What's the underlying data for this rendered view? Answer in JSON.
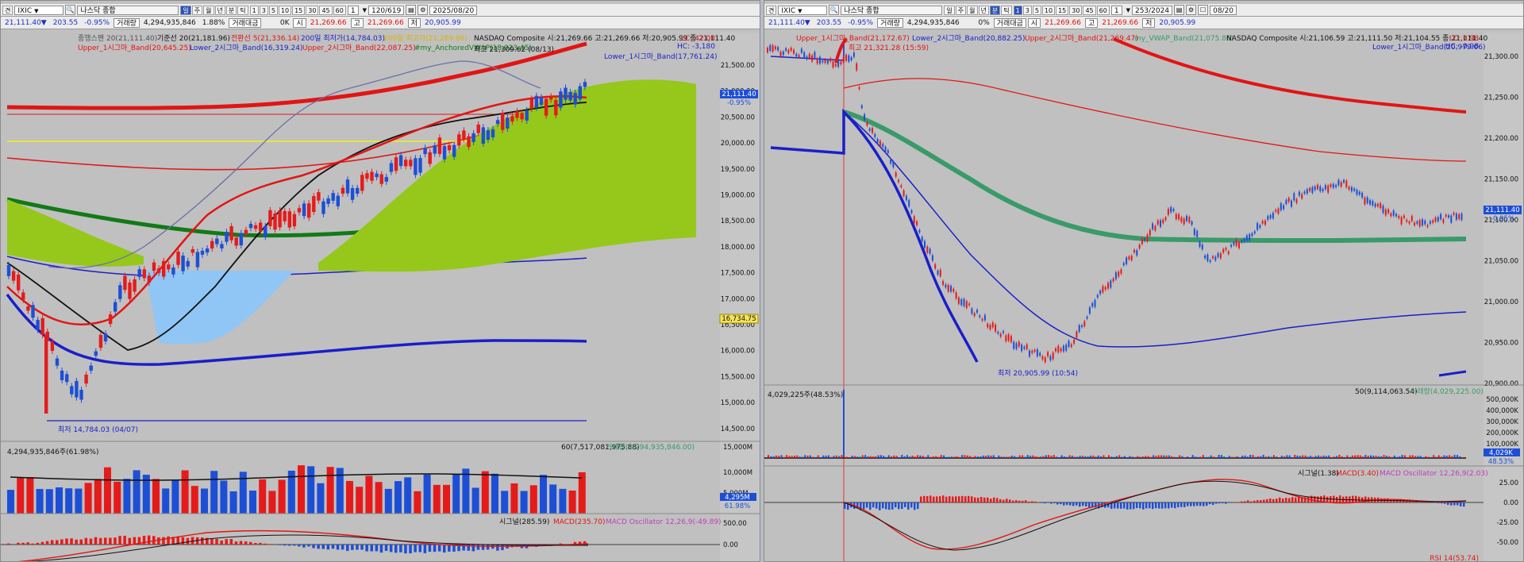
{
  "left": {
    "toolbar1": {
      "market_label": "견",
      "symbol": "IXIC",
      "name": "나스닥 종합",
      "period_buttons": [
        "일",
        "주",
        "월",
        "년",
        "분",
        "틱"
      ],
      "period_selected": 0,
      "intervals": [
        "1",
        "3",
        "5",
        "10",
        "15",
        "30",
        "45",
        "60"
      ],
      "count_value": "1",
      "range_value": "120/619",
      "date_value": "2025/08/20"
    },
    "toolbar2": {
      "price": "21,111.40▼",
      "change": "203.55",
      "change_pct": "-0.95%",
      "volume_label": "거래량",
      "volume": "4,294,935,846",
      "turnover_pct": "1.88%",
      "amount_label": "거래대금",
      "amount": "0K",
      "open_label": "시",
      "open": "21,269.66",
      "high_label": "고",
      "high": "21,269.66",
      "low_label": "저",
      "low": "20,905.99"
    },
    "legend": {
      "line1a": "종행스팬 20(21,111.40)",
      "line1b": "기준선 20(21,181.96)",
      "line1c": "전환선 5(21,336.14)",
      "line1d": "200일 최저가(14,784.03)",
      "line1e": "200일 최고가(21,269.66)",
      "line1f": "NASDAQ Composite 시:21,269.66 고:21,269.66 저:20,905.99 종:21,111.40",
      "line2a": "Upper_1시그마_Band(20,645.25)",
      "line2b": "Lower_2시그마_Band(16,319.24)",
      "line2c": "Upper_2시그마_Band(22,087.25)",
      "line2d": "#my_AnchoredVWAP(18,023.45)",
      "line3a": "Lower_1시그마_Band(17,761.24)",
      "line3b": "최고 21,309.62 (08/13)",
      "lc": "LC: 42.00",
      "hc": "HC: -3,180",
      "min_label": "최저 14,784.03 (04/07)"
    },
    "price_axis": [
      "21,500.00",
      "21,000.00",
      "20,500.00",
      "20,000.00",
      "19,500.00",
      "19,000.00",
      "18,500.00",
      "18,000.00",
      "17,500.00",
      "17,000.00",
      "16,500.00",
      "16,000.00",
      "15,500.00",
      "15,000.00",
      "14,500.00"
    ],
    "price_tag": "21,111.40",
    "price_tag_pct": "-0.95%",
    "vwap_tag": "16,734.75",
    "volume_label": "4,294,935,846주(61.98%)",
    "volume_ma_label": "60(7,517,081,975.88)",
    "volume_legend": "거래량(4,294,935,846.00)",
    "volume_axis": [
      "15,000M",
      "10,000M",
      "5,000M"
    ],
    "volume_tag": "4,295M",
    "volume_tag_pct": "61.98%",
    "macd_labels": [
      "시그널(285.59)",
      "MACD(235.70)",
      "MACD Oscillator 12,26,9(-49.89)"
    ],
    "macd_axis": [
      "500.00",
      "0.00"
    ]
  },
  "right": {
    "toolbar1": {
      "market_label": "견",
      "symbol": "IXIC",
      "name": "나스닥 종합",
      "period_buttons": [
        "일",
        "주",
        "월",
        "년",
        "분",
        "틱"
      ],
      "period_selected": 4,
      "intervals": [
        "1",
        "3",
        "5",
        "10",
        "15",
        "30",
        "45",
        "60"
      ],
      "interval_selected": 0,
      "count_value": "1",
      "range_value": "253/2024",
      "date_value": "08/20"
    },
    "toolbar2": {
      "price": "21,111.40▼",
      "change": "203.55",
      "change_pct": "-0.95%",
      "volume_label": "거래량",
      "volume": "4,294,935,846",
      "amount": "0%",
      "amount_label": "거래대금",
      "open_label": "시",
      "open": "21,269.66",
      "high_label": "고",
      "high": "21,269.66",
      "low_label": "저",
      "low": "20,905.99"
    },
    "legend": {
      "line1a": "Upper_1시그마_Band(21,172.67)",
      "line1b": "Lower_2시그마_Band(20,882.25)",
      "line1c": "Upper_2시그마_Band(21,269.47)",
      "line1d": "my_VWAP_Band(21,075.86)",
      "line1e": "NASDAQ Composite 시:21,106.59 고:21,111.50 저:21,104.55 종:21,111.40",
      "line2a": "Lower_1시그마_Band(20,979.06)",
      "high_label": "최고 21,321.28 (15:59)",
      "low_label": "최저 20,905.99 (10:54)",
      "lc": "LC: 0.98",
      "hc": "HC: -0.98"
    },
    "price_axis": [
      "21,300.00",
      "21,250.00",
      "21,200.00",
      "21,150.00",
      "21,100.00",
      "21,050.00",
      "21,000.00",
      "20,950.00",
      "20,900.00"
    ],
    "price_tag": "21,111.40",
    "price_tag_pct": "-0.95%",
    "volume_label": "4,029,225주(48.53%)",
    "volume_ma_label": "50(9,114,063.54)",
    "volume_legend": "거래량(4,029,225.00)",
    "volume_axis": [
      "500,000K",
      "400,000K",
      "300,000K",
      "200,000K",
      "100,000K"
    ],
    "volume_tag": "4,029K",
    "volume_tag_pct": "48.53%",
    "macd_labels": [
      "시그널(1.38)",
      "MACD(3.40)",
      "MACD Oscillator 12,26,9(2.03)"
    ],
    "macd_axis": [
      "25.00",
      "0.00",
      "-25.00",
      "-50.00"
    ],
    "rsi_label": "RSI 14(53.74)"
  },
  "colors": {
    "up_candle": "#e51b1b",
    "down_candle": "#1d4fd6",
    "cloud": "#95c81b",
    "cloud_blue": "#8fc6f5",
    "vwap_green": "#127a16",
    "vwap_teal": "#3a9a6a"
  }
}
